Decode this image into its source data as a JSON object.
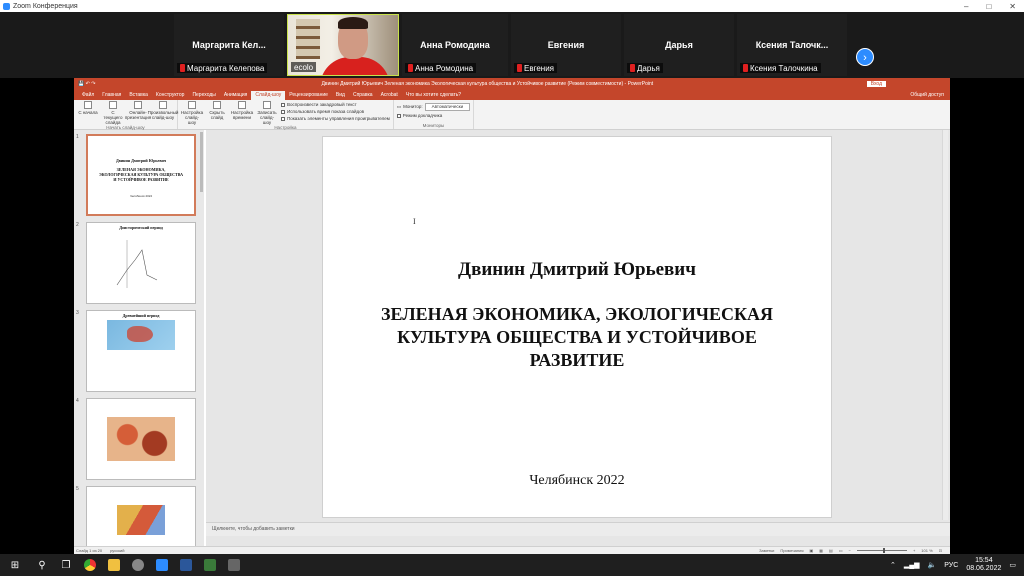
{
  "zoom_window": {
    "title": "Zoom Конференция"
  },
  "participants": [
    {
      "display_name": "Маргарита  Кел...",
      "tag_name": "Маргарита Келепова"
    },
    {
      "display_name": "",
      "tag_name": "ecolo"
    },
    {
      "display_name": "Анна Ромодина",
      "tag_name": "Анна Ромодина"
    },
    {
      "display_name": "Евгения",
      "tag_name": "Евгения"
    },
    {
      "display_name": "Дарья",
      "tag_name": "Дарья"
    },
    {
      "display_name": "Ксения  Талочк...",
      "tag_name": "Ксения Талочкина"
    }
  ],
  "powerpoint": {
    "document_title": "Двинин Дмитрий Юрьевич Зеленая экономика Экологическая культура общества и Устойчивое развитие (Режим совместимости) - PowerPoint",
    "login_label": "Вход",
    "tabs": [
      "Файл",
      "Главная",
      "Вставка",
      "Конструктор",
      "Переходы",
      "Анимация",
      "Слайд-шоу",
      "Рецензирование",
      "Вид",
      "Справка",
      "Acrobat",
      "Что вы хотите сделать?"
    ],
    "active_tab": "Слайд-шоу",
    "share_label": "Общий доступ",
    "ribbon": {
      "start_buttons": [
        "С начала",
        "С текущего слайда",
        "Онлайн-презентация",
        "Произвольный слайд-шоу"
      ],
      "start_group": "Начать слайд-шоу",
      "setup_buttons": [
        "Настройка слайд-шоу",
        "Скрыть слайд",
        "Настройка времени",
        "Записать слайд-шоу"
      ],
      "checkboxes": [
        "Воспроизвести закадровый текст",
        "Использовать время показа слайдов",
        "Показать элементы управления проигрывателем"
      ],
      "setup_group": "Настройка",
      "monitor_label": "Монитор:",
      "monitor_value": "Автоматически",
      "presenter_label": "Режим докладчика",
      "monitors_group": "Мониторы"
    },
    "thumbnails": [
      {
        "num": "1",
        "author": "Двинин Дмитрий Юрьевич",
        "title": "ЗЕЛЕНАЯ ЭКОНОМИКА, ЭКОЛОГИЧЕСКАЯ КУЛЬТУРА ОБЩЕСТВА И УСТОЙЧИВОЕ РАЗВИТИЕ",
        "city": "Челябинск 2022"
      },
      {
        "num": "2",
        "title": "Доисторический период"
      },
      {
        "num": "3",
        "title": "Древнейший период"
      },
      {
        "num": "4"
      },
      {
        "num": "5"
      }
    ],
    "slide": {
      "author": "Двинин Дмитрий Юрьевич",
      "title": "ЗЕЛЕНАЯ ЭКОНОМИКА, ЭКОЛОГИЧЕСКАЯ КУЛЬТУРА ОБЩЕСТВА И УСТОЙЧИВОЕ РАЗВИТИЕ",
      "city": "Челябинск 2022"
    },
    "notes_placeholder": "Щелкните, чтобы добавить заметки",
    "status": {
      "slide_counter": "Слайд 1 из 20",
      "language": "русский",
      "notes_button": "Заметки",
      "comments_button": "Примечания",
      "zoom": "101 %"
    }
  },
  "taskbar": {
    "language": "РУС",
    "time": "15:54",
    "date": "08.06.2022"
  },
  "colors": {
    "powerpoint_accent": "#c4462b",
    "zoom_blue": "#2d8cff",
    "active_speaker_border": "#c9e24a"
  }
}
